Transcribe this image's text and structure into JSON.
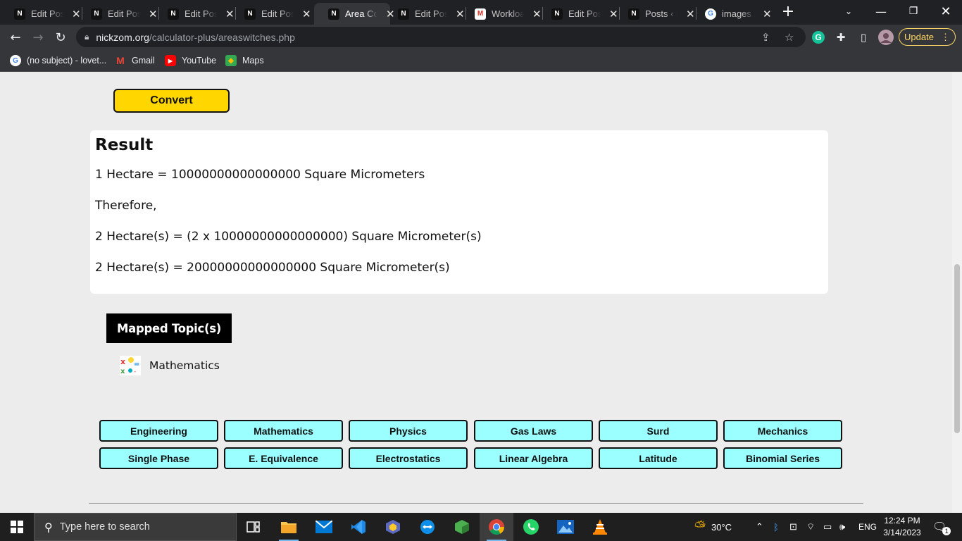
{
  "browser": {
    "tabs": [
      {
        "title": "Edit Post",
        "favicon": "nickzom-icon",
        "active": false
      },
      {
        "title": "Edit Post",
        "favicon": "nickzom-icon",
        "active": false
      },
      {
        "title": "Edit Post",
        "favicon": "nickzom-icon",
        "active": false
      },
      {
        "title": "Edit Post",
        "favicon": "nickzom-icon",
        "active": false
      },
      {
        "title": "Area Con",
        "favicon": "nickzom-icon",
        "active": true
      },
      {
        "title": "Edit Post",
        "favicon": "nickzom-icon",
        "active": false
      },
      {
        "title": "Workloa",
        "favicon": "gmail-icon",
        "active": false
      },
      {
        "title": "Edit Post",
        "favicon": "nickzom-icon",
        "active": false
      },
      {
        "title": "Posts ‹ N",
        "favicon": "nickzom-icon",
        "active": false
      },
      {
        "title": "images c",
        "favicon": "google-icon",
        "active": false
      }
    ],
    "url_domain": "nickzom.org",
    "url_path": "/calculator-plus/areaswitches.php",
    "update_label": "Update",
    "bookmarks": [
      {
        "label": "(no subject) - lovet...",
        "icon": "google-icon"
      },
      {
        "label": "Gmail",
        "icon": "gmail-icon"
      },
      {
        "label": "YouTube",
        "icon": "youtube-icon"
      },
      {
        "label": "Maps",
        "icon": "maps-icon"
      }
    ]
  },
  "page": {
    "convert_label": "Convert",
    "result": {
      "title": "Result",
      "lines": [
        "1 Hectare = 10000000000000000 Square Micrometers",
        "Therefore,",
        "2 Hectare(s) = (2 x 10000000000000000) Square Micrometer(s)",
        "2 Hectare(s) = 20000000000000000 Square Micrometer(s)"
      ]
    },
    "mapped_topics": {
      "header": "Mapped Topic(s)",
      "items": [
        {
          "label": "Mathematics",
          "icon": "mathematics-icon"
        }
      ]
    },
    "categories": [
      "Engineering",
      "Mathematics",
      "Physics",
      "Gas Laws",
      "Surd",
      "Mechanics",
      "Single Phase",
      "E. Equivalence",
      "Electrostatics",
      "Linear Algebra",
      "Latitude",
      "Binomial Series"
    ]
  },
  "taskbar": {
    "search_placeholder": "Type here to search",
    "weather": "30°C",
    "language": "ENG",
    "time": "12:24 PM",
    "date": "3/14/2023",
    "notification_count": "1",
    "apps": [
      "task-view-icon",
      "file-explorer-icon",
      "mail-icon",
      "vscode-icon",
      "virtualbox-icon",
      "teamviewer-icon",
      "minecraft-icon",
      "chrome-icon",
      "whatsapp-icon",
      "photos-icon",
      "vlc-icon"
    ]
  },
  "colors": {
    "convert_button": "#ffd600",
    "category_button": "#9bffff",
    "chrome_dark": "#202124",
    "update_accent": "#fdd663"
  }
}
